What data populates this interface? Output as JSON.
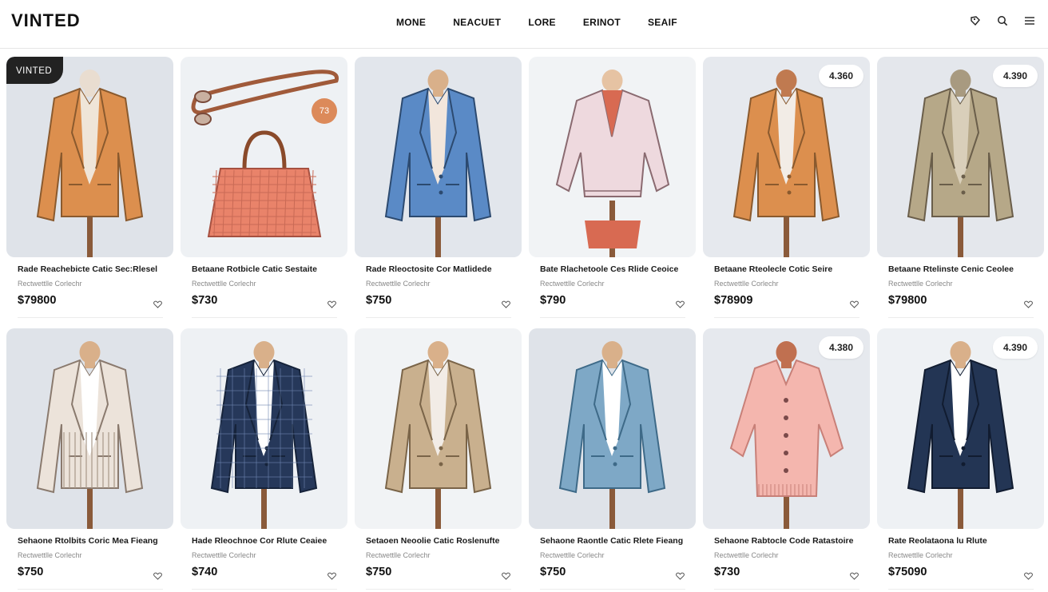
{
  "header": {
    "logo": "VINTED",
    "nav": [
      "MONE",
      "NEACUET",
      "LORE",
      "ERINOT",
      "SEAIF"
    ],
    "icons": [
      "tag-icon",
      "search-icon",
      "menu-icon"
    ]
  },
  "colors": {
    "accent": "#dc8a5a",
    "badge_dark": "#222222"
  },
  "listings": [
    {
      "title": "Rade Reachebicte Catic Sec:Rlesel",
      "subtitle": "Rectwettlle Corlechr",
      "price": "$79800",
      "badge": "VINTED",
      "garment": "camel-jacket",
      "bg": "#dfe3e9"
    },
    {
      "title": "Betaane Rotbicle Catic Sestaite",
      "subtitle": "Rectwettlle Corlechr",
      "price": "$730",
      "badge": "73",
      "garment": "bag",
      "bg": "#eef1f4"
    },
    {
      "title": "Rade Rleoctosite Cor Matlidede",
      "subtitle": "Rectwettlle Corlechr",
      "price": "$750",
      "badge": "",
      "garment": "blue-blazer",
      "bg": "#e2e6ec"
    },
    {
      "title": "Bate Rlachetoole Ces Rlide Ceoice",
      "subtitle": "Rectwettlle Corlechr",
      "price": "$790",
      "badge": "",
      "garment": "cardigan",
      "bg": "#f1f3f5"
    },
    {
      "title": "Betaane Rteolecle Cotic Seire",
      "subtitle": "Rectwettlle Corlechr",
      "price": "$78909",
      "badge": "4.360",
      "garment": "camel-blazer",
      "bg": "#e6e9ee"
    },
    {
      "title": "Betaane Rtelinste Cenic Ceolee",
      "subtitle": "Rectwettlle Corlechr",
      "price": "$79800",
      "badge": "4.390",
      "garment": "khaki-coat",
      "bg": "#e4e7ec"
    },
    {
      "title": "Sehaone Rtolbits Coric Mea Fieang",
      "subtitle": "Rectwettlle Corlechr",
      "price": "$750",
      "badge": "",
      "garment": "stripe-jacket",
      "bg": "#dfe3e9"
    },
    {
      "title": "Hade Rleochnoe Cor Rlute Ceaiee",
      "subtitle": "Rectwettlle Corlechr",
      "price": "$740",
      "badge": "",
      "garment": "navy-check",
      "bg": "#eef1f4"
    },
    {
      "title": "Setaoen Neoolie Catic Roslenufte",
      "subtitle": "Rectwettlle Corlechr",
      "price": "$750",
      "badge": "",
      "garment": "beige-jacket",
      "bg": "#f1f3f5"
    },
    {
      "title": "Sehaone Raontle Catic Rlete Fieang",
      "subtitle": "Rectwettlle Corlechr",
      "price": "$750",
      "badge": "",
      "garment": "denim-jacket",
      "bg": "#dfe3e9"
    },
    {
      "title": "Sehaone Rabtocle Code Ratastoire",
      "subtitle": "Rectwettlle Corlechr",
      "price": "$730",
      "badge": "4.380",
      "garment": "pink-cardigan",
      "bg": "#e6e9ee"
    },
    {
      "title": "Rate Reolataona lu Rlute",
      "subtitle": "Rectwettlle Corlechr",
      "price": "$75090",
      "badge": "4.390",
      "garment": "navy-coat",
      "bg": "#eef1f4"
    }
  ]
}
